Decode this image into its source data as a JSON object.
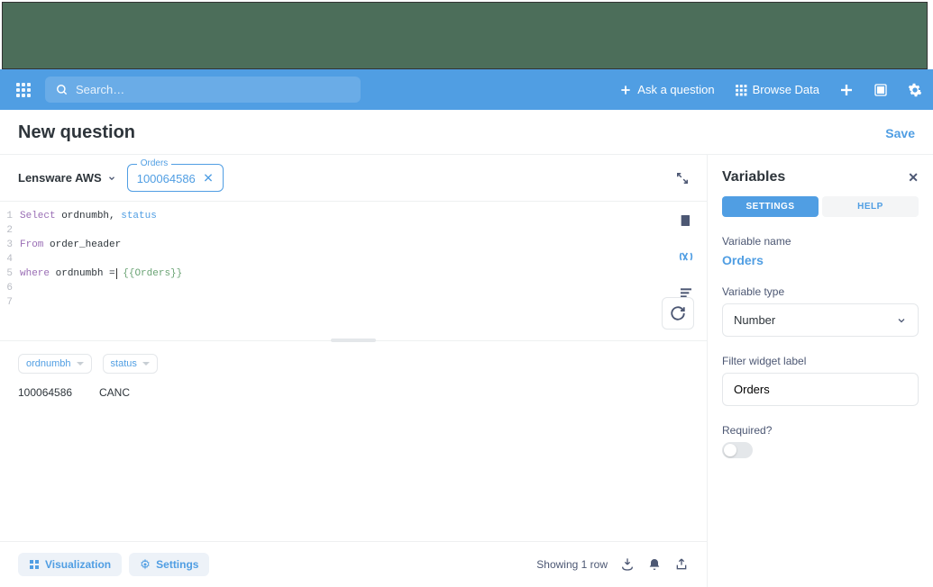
{
  "nav": {
    "search_placeholder": "Search…",
    "ask": "Ask a question",
    "browse": "Browse Data"
  },
  "header": {
    "title": "New question",
    "save": "Save"
  },
  "filter": {
    "database": "Lensware AWS",
    "var_label": "Orders",
    "var_value": "100064586"
  },
  "editor": {
    "lines": [
      "1",
      "2",
      "3",
      "4",
      "5",
      "6",
      "7"
    ],
    "code": {
      "l1_pre": "Select",
      "l1_c1": " ordnumbh, ",
      "l1_c2": "status",
      "l2_pre": "From",
      "l2_rest": " order_header",
      "l3_pre": "where",
      "l3_rest": " ordnumbh =",
      "l3_tmpl": " {{Orders}}"
    }
  },
  "results": {
    "columns": [
      "ordnumbh",
      "status"
    ],
    "rows": [
      [
        "100064586",
        "CANC"
      ]
    ]
  },
  "bottom": {
    "viz": "Visualization",
    "settings": "Settings",
    "count": "Showing 1 row"
  },
  "panel": {
    "title": "Variables",
    "tab_settings": "SETTINGS",
    "tab_help": "HELP",
    "name_label": "Variable name",
    "name_value": "Orders",
    "type_label": "Variable type",
    "type_value": "Number",
    "widget_label": "Filter widget label",
    "widget_value": "Orders",
    "required_label": "Required?"
  }
}
